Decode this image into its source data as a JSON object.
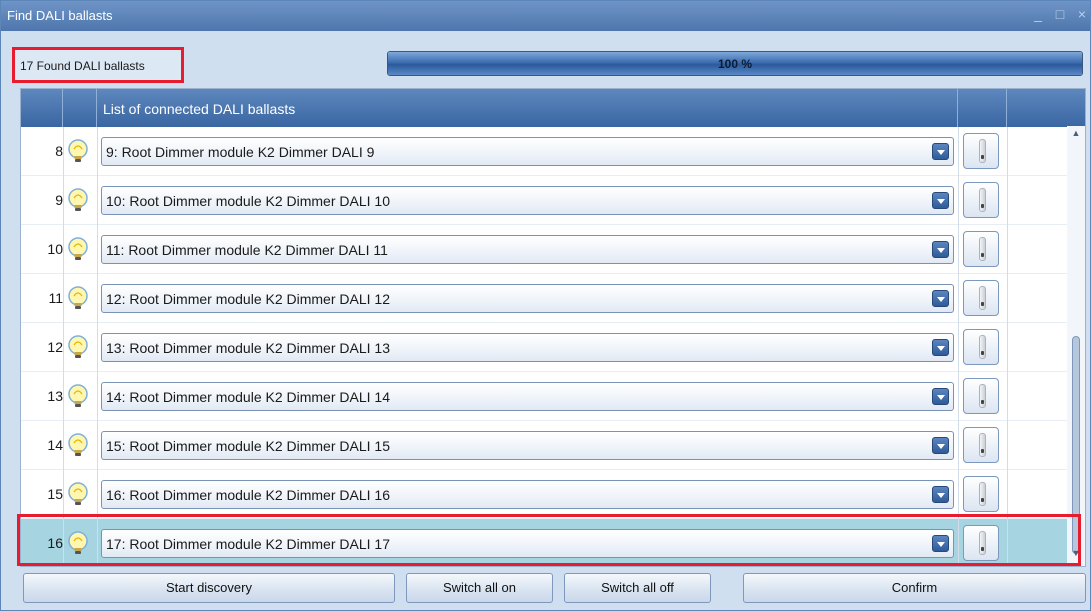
{
  "window": {
    "title": "Find DALI ballasts",
    "minimize_glyph": "_",
    "maximize_glyph": "□",
    "close_glyph": "×"
  },
  "status": {
    "found_text": "17 Found DALI ballasts"
  },
  "progress": {
    "value": 100,
    "label": "100 %"
  },
  "grid": {
    "header_title": "List of connected DALI ballasts",
    "rows": [
      {
        "num": "8",
        "ballast": "9: Root Dimmer module K2 Dimmer DALI 9"
      },
      {
        "num": "9",
        "ballast": "10: Root Dimmer module K2 Dimmer DALI 10"
      },
      {
        "num": "10",
        "ballast": "11: Root Dimmer module K2 Dimmer DALI 11"
      },
      {
        "num": "11",
        "ballast": "12: Root Dimmer module K2 Dimmer DALI 12"
      },
      {
        "num": "12",
        "ballast": "13: Root Dimmer module K2 Dimmer DALI 13"
      },
      {
        "num": "13",
        "ballast": "14: Root Dimmer module K2 Dimmer DALI 14"
      },
      {
        "num": "14",
        "ballast": "15: Root Dimmer module K2 Dimmer DALI 15"
      },
      {
        "num": "15",
        "ballast": "16: Root Dimmer module K2 Dimmer DALI 16"
      },
      {
        "num": "16",
        "ballast": "17: Root Dimmer module K2 Dimmer DALI 17",
        "selected": true
      }
    ],
    "row_icon": "light-bulb-icon",
    "switch_icon": "toggle-switch-icon"
  },
  "buttons": {
    "start_discovery": "Start discovery",
    "switch_all_on": "Switch all on",
    "switch_all_off": "Switch all off",
    "confirm": "Confirm"
  },
  "colors": {
    "title_bar": "#4f77ad",
    "highlight": "#e81c2e",
    "selected_row": "#a6d4e1"
  }
}
